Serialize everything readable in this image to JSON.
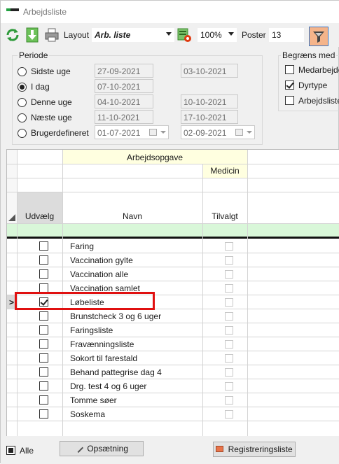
{
  "window": {
    "title": "Arbejdsliste"
  },
  "toolbar": {
    "layout_label": "Layout",
    "layout_value": "Arb. liste",
    "zoom_value": "100%",
    "poster_label": "Poster",
    "poster_value": "13",
    "icons": [
      "refresh-icon",
      "download-icon",
      "print-icon",
      "layout-settings-icon",
      "filter-icon"
    ]
  },
  "periode": {
    "legend": "Periode",
    "options": [
      {
        "label": "Sidste uge",
        "from": "27-09-2021",
        "to": "03-10-2021",
        "selected": false
      },
      {
        "label": "I dag",
        "from": "07-10-2021",
        "to": "",
        "selected": true
      },
      {
        "label": "Denne uge",
        "from": "04-10-2021",
        "to": "10-10-2021",
        "selected": false
      },
      {
        "label": "Næste uge",
        "from": "11-10-2021",
        "to": "17-10-2021",
        "selected": false
      },
      {
        "label": "Brugerdefineret",
        "from": "01-07-2021",
        "to": "02-09-2021",
        "selected": false
      }
    ]
  },
  "begraens": {
    "legend": "Begræns med",
    "items": [
      {
        "label": "Medarbejder",
        "checked": false
      },
      {
        "label": "Dyrtype",
        "checked": true
      },
      {
        "label": "Arbejdsliste",
        "checked": false
      }
    ]
  },
  "grid": {
    "group_header": "Arbejdsopgave",
    "sub_header": "Medicin",
    "col_udvaelg": "Udvælg",
    "col_navn": "Navn",
    "col_tilvalgt": "Tilvalgt",
    "row_indicator": ">",
    "rows": [
      {
        "name": "Faring",
        "checked": false
      },
      {
        "name": "Vaccination gylte",
        "checked": false
      },
      {
        "name": "Vaccination alle",
        "checked": false
      },
      {
        "name": "Vaccination samlet",
        "checked": false
      },
      {
        "name": "Løbeliste",
        "checked": true
      },
      {
        "name": "Brunstcheck 3 og 6 uger",
        "checked": false
      },
      {
        "name": "Faringsliste",
        "checked": false
      },
      {
        "name": "Fravænningsliste",
        "checked": false
      },
      {
        "name": "Sokort til farestald",
        "checked": false
      },
      {
        "name": "Behand pattegrise dag 4",
        "checked": false
      },
      {
        "name": "Drg. test 4 og 6 uger",
        "checked": false
      },
      {
        "name": "Tomme søer",
        "checked": false
      },
      {
        "name": "Soskema",
        "checked": false
      }
    ]
  },
  "bottom": {
    "alle_label": "Alle",
    "opsaetning_label": "Opsætning",
    "registrering_label": "Registreringsliste"
  },
  "colors": {
    "highlight": "#e01010",
    "header_yellow": "#ffffe0",
    "filter_row_green": "#d9f7d9",
    "filter_button": "#f5b48a"
  }
}
